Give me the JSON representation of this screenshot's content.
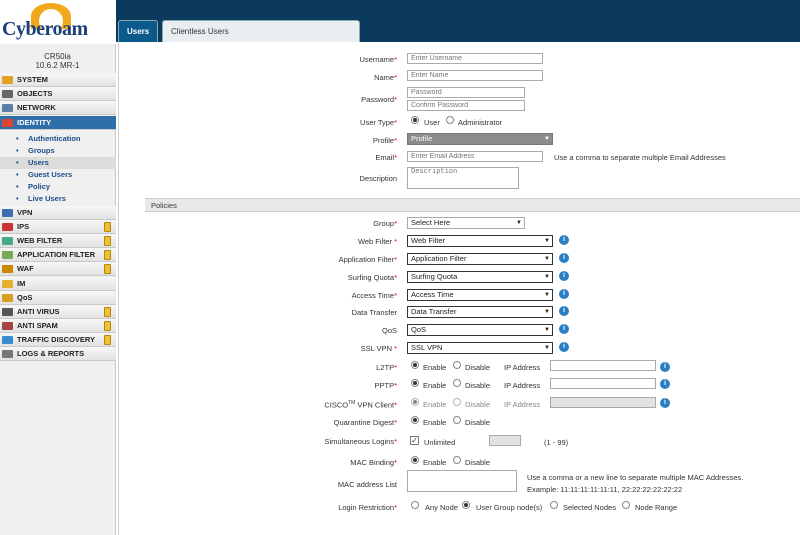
{
  "app": {
    "logo_text": "Cyberoam",
    "device_model": "CR50ia",
    "device_version": "10.6.2 MR-1"
  },
  "tabs": [
    "Users",
    "Clientless Users"
  ],
  "sidebar": {
    "items": [
      {
        "label": "SYSTEM",
        "icon": "system-icon"
      },
      {
        "label": "OBJECTS",
        "icon": "objects-icon"
      },
      {
        "label": "NETWORK",
        "icon": "network-icon"
      },
      {
        "label": "IDENTITY",
        "icon": "identity-icon"
      },
      {
        "label": "VPN",
        "icon": "vpn-icon"
      },
      {
        "label": "IPS",
        "icon": "ips-icon"
      },
      {
        "label": "WEB FILTER",
        "icon": "web-filter-icon"
      },
      {
        "label": "APPLICATION FILTER",
        "icon": "application-filter-icon"
      },
      {
        "label": "WAF",
        "icon": "waf-icon"
      },
      {
        "label": "IM",
        "icon": "im-icon"
      },
      {
        "label": "QoS",
        "icon": "qos-icon"
      },
      {
        "label": "ANTI VIRUS",
        "icon": "anti-virus-icon"
      },
      {
        "label": "ANTI SPAM",
        "icon": "anti-spam-icon"
      },
      {
        "label": "TRAFFIC DISCOVERY",
        "icon": "traffic-discovery-icon"
      },
      {
        "label": "LOGS & REPORTS",
        "icon": "logs-reports-icon"
      }
    ],
    "identity_sub": [
      "Authentication",
      "Groups",
      "Users",
      "Guest Users",
      "Policy",
      "Live Users"
    ]
  },
  "form": {
    "username": {
      "label": "Username",
      "placeholder": "Enter Username"
    },
    "name": {
      "label": "Name",
      "placeholder": "Enter Name"
    },
    "password": {
      "label": "Password",
      "placeholder": "Password",
      "confirm_placeholder": "Confirm Password"
    },
    "user_type": {
      "label": "User Type",
      "options": [
        "User",
        "Administrator"
      ],
      "selected": "User"
    },
    "profile": {
      "label": "Profile",
      "value": "Profile"
    },
    "email": {
      "label": "Email",
      "placeholder": "Enter Email Address",
      "hint": "Use a comma to separate multiple Email Addresses"
    },
    "description": {
      "label": "Description",
      "placeholder": "Description"
    }
  },
  "policies": {
    "title": "Policies",
    "group": {
      "label": "Group",
      "value": "Select Here"
    },
    "web_filter": {
      "label": "Web Filter",
      "value": "Web Filter"
    },
    "application_filter": {
      "label": "Application Filter",
      "value": "Application Filter"
    },
    "surfing_quota": {
      "label": "Surfing Quota",
      "value": "Surfing Quota"
    },
    "access_time": {
      "label": "Access Time",
      "value": "Access Time"
    },
    "data_transfer": {
      "label": "Data Transfer",
      "value": "Data Transfer"
    },
    "qos": {
      "label": "QoS",
      "value": "QoS"
    },
    "ssl_vpn": {
      "label": "SSL VPN",
      "value": "SSL VPN"
    },
    "l2tp": {
      "label": "L2TP",
      "enable": "Enable",
      "disable": "Disable",
      "ip_label": "IP Address",
      "selected": "Enable"
    },
    "pptp": {
      "label": "PPTP",
      "enable": "Enable",
      "disable": "Disable",
      "ip_label": "IP Address",
      "selected": "Enable"
    },
    "cisco_vpn": {
      "label_pre": "CISCO",
      "label_tm": "TM",
      "label_post": " VPN Client",
      "enable": "Enable",
      "disable": "Disable",
      "ip_label": "IP Address",
      "selected": "Enable"
    },
    "quarantine": {
      "label": "Quarantine Digest",
      "enable": "Enable",
      "disable": "Disable",
      "selected": "Enable"
    },
    "simultaneous": {
      "label": "Simultaneous Logins",
      "unlimited": "Unlimited",
      "range": "(1 - 99)",
      "checked": true
    },
    "mac_binding": {
      "label": "MAC Binding",
      "enable": "Enable",
      "disable": "Disable",
      "selected": "Enable"
    },
    "mac_list": {
      "label": "MAC address List",
      "hint": "Use a comma or a new line to separate multiple MAC Addresses.",
      "example": "Example: 11:11:11:11:11:11, 22:22:22:22:22:22"
    },
    "login_restriction": {
      "label": "Login Restriction",
      "options": [
        "Any Node",
        "User Group node(s)",
        "Selected Nodes",
        "Node Range"
      ],
      "selected": "User Group node(s)"
    }
  },
  "colors": {
    "topbar": "#0b3a5e",
    "tab_active": "#0b5a8c",
    "sidebar_active": "#2d6fa6",
    "info_icon": "#2a7fc4",
    "required": "#cc0000"
  }
}
